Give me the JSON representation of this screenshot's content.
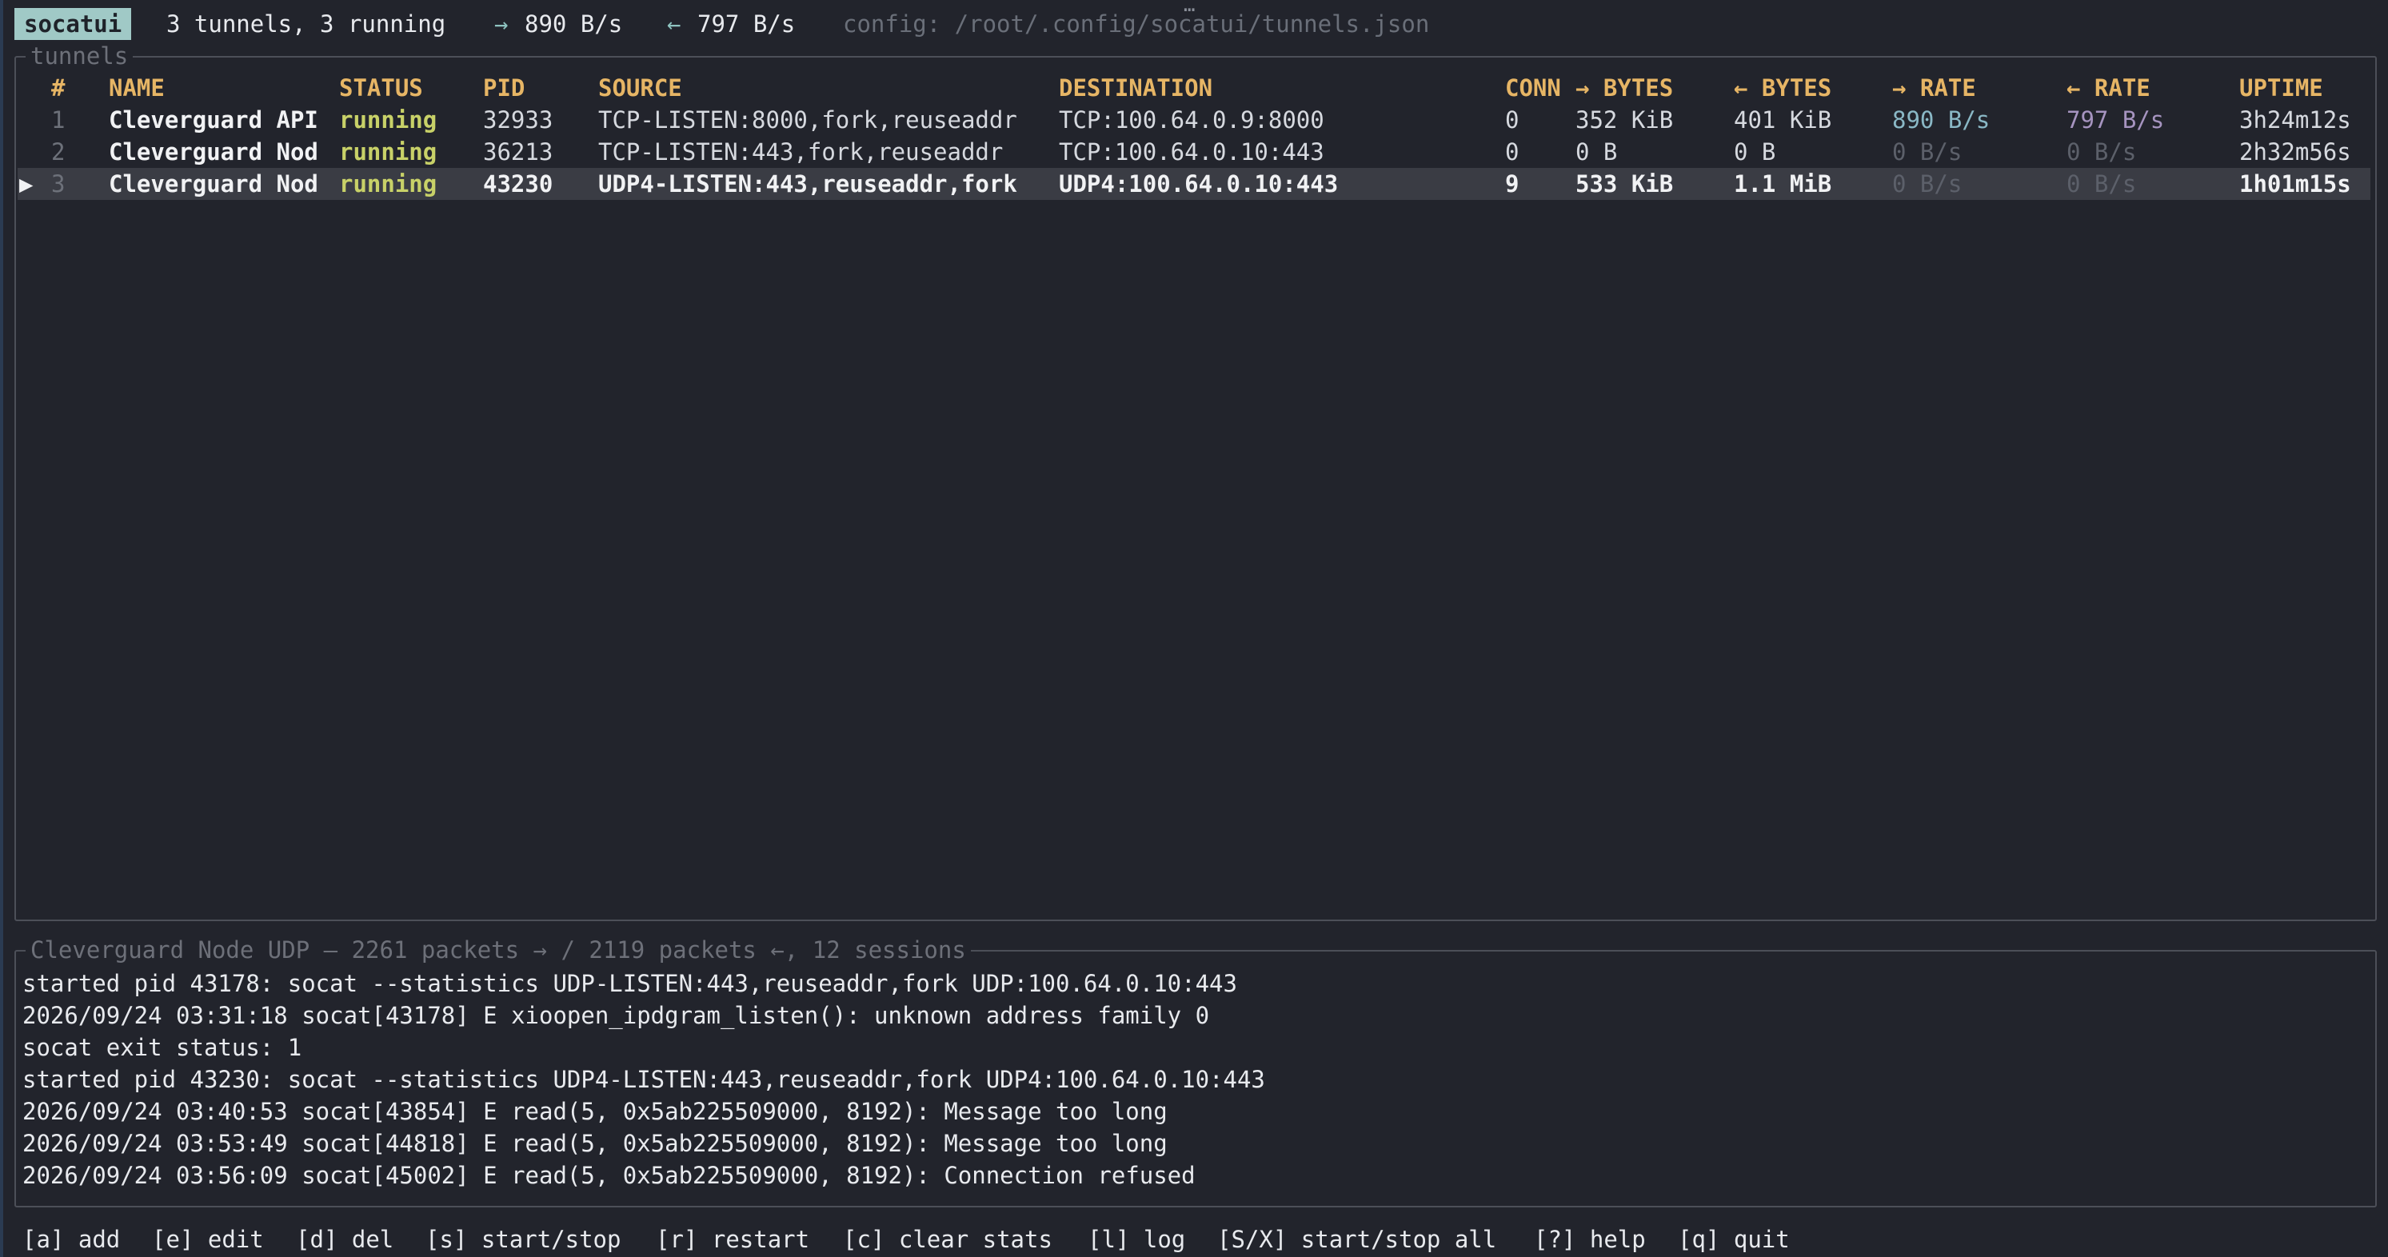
{
  "header": {
    "app_name": "socatui",
    "summary": "3 tunnels, 3 running",
    "out_arrow": "→",
    "out_rate": "890 B/s",
    "in_arrow": "←",
    "in_rate": "797 B/s",
    "config": "config: /root/.config/socatui/tunnels.json",
    "dots": "…"
  },
  "tunnels_panel": {
    "title": "tunnels",
    "columns": [
      "#",
      "NAME",
      "STATUS",
      "PID",
      "SOURCE",
      "DESTINATION",
      "CONN",
      "→ BYTES",
      "← BYTES",
      "→ RATE",
      "← RATE",
      "UPTIME"
    ],
    "selected_marker": "▶",
    "rows": [
      {
        "num": "1",
        "name": "Cleverguard API",
        "status": "running",
        "pid": "32933",
        "source": "TCP-LISTEN:8000,fork,reuseaddr",
        "destination": "TCP:100.64.0.9:8000",
        "conn": "0",
        "out_bytes": "352 KiB",
        "in_bytes": "401 KiB",
        "out_rate": "890 B/s",
        "in_rate": "797 B/s",
        "uptime": "3h24m12s"
      },
      {
        "num": "2",
        "name": "Cleverguard Nod",
        "status": "running",
        "pid": "36213",
        "source": "TCP-LISTEN:443,fork,reuseaddr",
        "destination": "TCP:100.64.0.10:443",
        "conn": "0",
        "out_bytes": "0 B",
        "in_bytes": "0 B",
        "out_rate": "0 B/s",
        "in_rate": "0 B/s",
        "uptime": "2h32m56s"
      },
      {
        "num": "3",
        "name": "Cleverguard Nod",
        "status": "running",
        "pid": "43230",
        "source": "UDP4-LISTEN:443,reuseaddr,fork",
        "destination": "UDP4:100.64.0.10:443",
        "conn": "9",
        "out_bytes": "533 KiB",
        "in_bytes": "1.1 MiB",
        "out_rate": "0 B/s",
        "in_rate": "0 B/s",
        "uptime": "1h01m15s"
      }
    ]
  },
  "log_panel": {
    "title": "Cleverguard Node UDP — 2261 packets → / 2119 packets ←, 12 sessions",
    "lines": [
      "started pid 43178: socat --statistics UDP-LISTEN:443,reuseaddr,fork UDP:100.64.0.10:443",
      "2026/09/24 03:31:18 socat[43178] E xioopen_ipdgram_listen(): unknown address family 0",
      "socat exit status: 1",
      "started pid 43230: socat --statistics UDP4-LISTEN:443,reuseaddr,fork UDP4:100.64.0.10:443",
      "2026/09/24 03:40:53 socat[43854] E read(5, 0x5ab225509000, 8192): Message too long",
      "2026/09/24 03:53:49 socat[44818] E read(5, 0x5ab225509000, 8192): Message too long",
      "2026/09/24 03:56:09 socat[45002] E read(5, 0x5ab225509000, 8192): Connection refused"
    ]
  },
  "footer": {
    "keys": [
      {
        "key": "[a]",
        "label": "add"
      },
      {
        "key": "[e]",
        "label": "edit"
      },
      {
        "key": "[d]",
        "label": "del"
      },
      {
        "key": "[s]",
        "label": "start/stop"
      },
      {
        "key": "[r]",
        "label": "restart"
      },
      {
        "key": "[c]",
        "label": "clear stats"
      },
      {
        "key": "[l]",
        "label": "log"
      },
      {
        "key": "[S/X]",
        "label": "start/stop all"
      },
      {
        "key": "[?]",
        "label": "help"
      },
      {
        "key": "[q]",
        "label": "quit"
      }
    ]
  },
  "colors": {
    "background": "#22242c",
    "accent_header": "#e6b565",
    "status_running": "#c8d168",
    "badge": "#a0c9c6"
  }
}
